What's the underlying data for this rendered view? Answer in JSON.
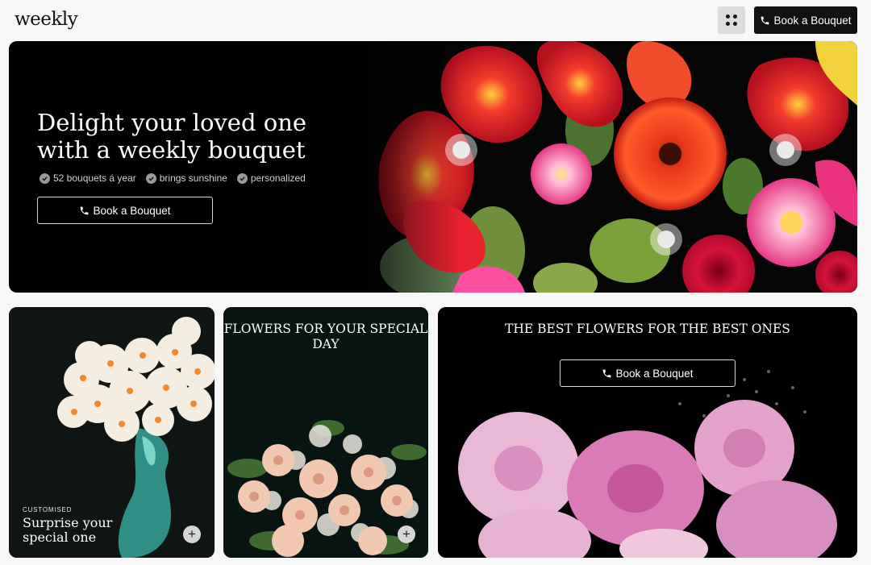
{
  "header": {
    "logo": "weekly",
    "menu_icon": "grid-dots-icon",
    "book_label": "Book a Bouquet"
  },
  "hero": {
    "title": "Delight your loved one with a weekly bouquet",
    "features": [
      {
        "icon": "check-circle-icon",
        "label": "52 bouquets á year"
      },
      {
        "icon": "check-circle-icon",
        "label": "brings sunshine"
      },
      {
        "icon": "check-circle-icon",
        "label": "personalized"
      }
    ],
    "cta_label": "Book a Bouquet"
  },
  "cards": {
    "custom": {
      "eyebrow": "CUSTOMISED",
      "title": "Surprise your special one",
      "plus": "+"
    },
    "special_day": {
      "title": "FLOWERS FOR YOUR SPECIAL DAY",
      "plus": "+"
    },
    "best": {
      "title": "THE BEST FLOWERS FOR THE BEST ONES",
      "cta_label": "Book a Bouquet"
    }
  },
  "colors": {
    "background": "#f7f7f7",
    "dark": "#111111",
    "card": "#000000"
  }
}
